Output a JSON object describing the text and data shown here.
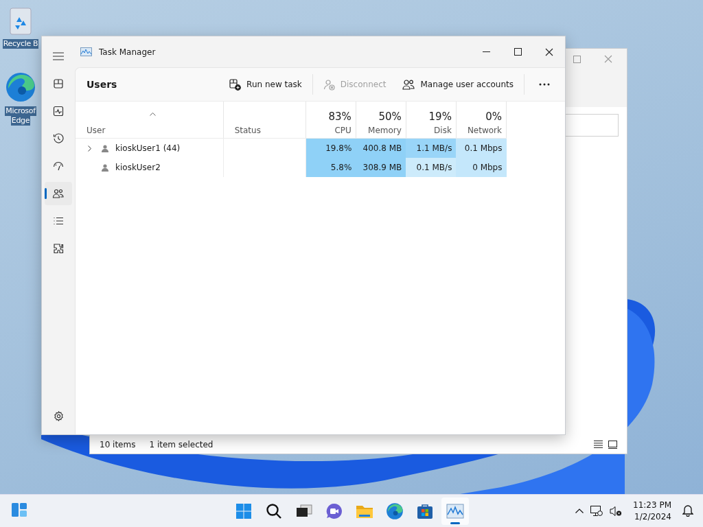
{
  "desktop_icons": [
    {
      "kind": "recycle",
      "lines": [
        "Recycle B"
      ]
    },
    {
      "kind": "edge",
      "lines": [
        "Microsof",
        "Edge"
      ]
    }
  ],
  "background_window": {
    "status_bar": {
      "item_count": "10 items",
      "selection": "1 item selected"
    }
  },
  "task_manager": {
    "title": "Task Manager",
    "nav_items": [
      {
        "kind": "processes",
        "selected": false
      },
      {
        "kind": "performance",
        "selected": false
      },
      {
        "kind": "history",
        "selected": false
      },
      {
        "kind": "startup",
        "selected": false
      },
      {
        "kind": "users",
        "selected": true
      },
      {
        "kind": "details",
        "selected": false
      },
      {
        "kind": "services",
        "selected": false
      }
    ],
    "page_title": "Users",
    "toolbar": [
      {
        "kind": "run",
        "label": "Run new task",
        "disabled": false
      },
      {
        "kind": "disconnect",
        "label": "Disconnect",
        "disabled": true
      },
      {
        "kind": "accounts",
        "label": "Manage user accounts",
        "disabled": false
      }
    ],
    "columns": [
      {
        "label": "User"
      },
      {
        "label": "Status"
      },
      {
        "percent": "83%",
        "label": "CPU"
      },
      {
        "percent": "50%",
        "label": "Memory"
      },
      {
        "percent": "19%",
        "label": "Disk"
      },
      {
        "percent": "0%",
        "label": "Network"
      }
    ],
    "rows": [
      {
        "expandable": true,
        "cells": [
          {
            "text": "kioskUser1 (44)"
          },
          {
            "text": ""
          },
          {
            "text": "19.8%",
            "color": "#8fd1f7"
          },
          {
            "text": "400.8 MB",
            "color": "#8fd1f7"
          },
          {
            "text": "1.1 MB/s",
            "color": "#99d5f8"
          },
          {
            "text": "0.1 Mbps",
            "color": "#c4e7fb"
          }
        ]
      },
      {
        "expandable": false,
        "cells": [
          {
            "text": "kioskUser2"
          },
          {
            "text": ""
          },
          {
            "text": "5.8%",
            "color": "#8fd1f7"
          },
          {
            "text": "308.9 MB",
            "color": "#8fd1f7"
          },
          {
            "text": "0.1 MB/s",
            "color": "#cdebfb"
          },
          {
            "text": "0 Mbps",
            "color": "#c4e7fb"
          }
        ]
      }
    ]
  },
  "taskbar": {
    "apps": [
      {
        "kind": "start",
        "selected": false
      },
      {
        "kind": "search",
        "selected": false
      },
      {
        "kind": "taskview",
        "selected": false
      },
      {
        "kind": "chat",
        "selected": false
      },
      {
        "kind": "explorer",
        "selected": false
      },
      {
        "kind": "edge",
        "selected": false
      },
      {
        "kind": "store",
        "selected": false
      },
      {
        "kind": "taskmgr",
        "selected": true
      }
    ],
    "time": "11:23 PM",
    "date": "1/2/2024"
  }
}
